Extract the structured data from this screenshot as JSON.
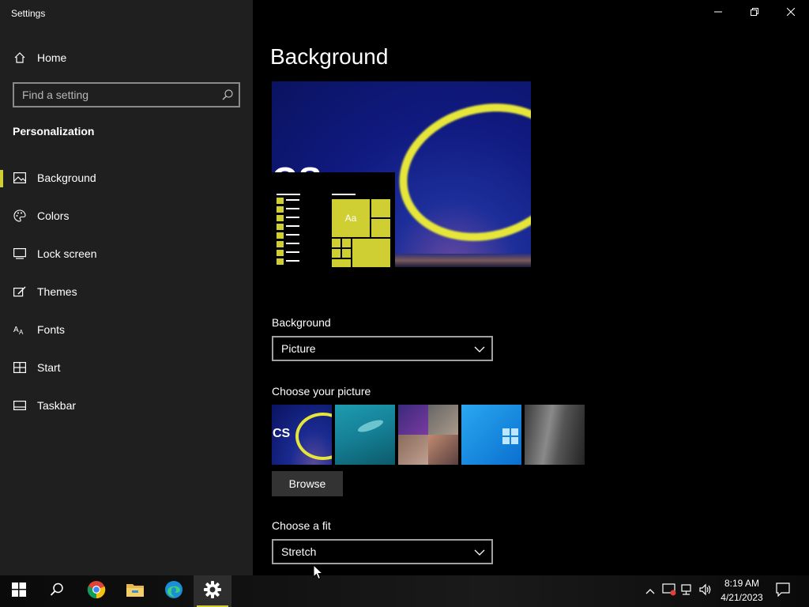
{
  "window": {
    "title": "Settings"
  },
  "sidebar": {
    "home_label": "Home",
    "search_placeholder": "Find a setting",
    "section_title": "Personalization",
    "items": [
      {
        "label": "Background",
        "icon": "picture-icon",
        "active": true
      },
      {
        "label": "Colors",
        "icon": "palette-icon",
        "active": false
      },
      {
        "label": "Lock screen",
        "icon": "lock-screen-icon",
        "active": false
      },
      {
        "label": "Themes",
        "icon": "themes-icon",
        "active": false
      },
      {
        "label": "Fonts",
        "icon": "fonts-icon",
        "active": false
      },
      {
        "label": "Start",
        "icon": "start-icon",
        "active": false
      },
      {
        "label": "Taskbar",
        "icon": "taskbar-icon",
        "active": false
      }
    ]
  },
  "main": {
    "title": "Background",
    "preview": {
      "sample_tile_text": "Aa",
      "wallpaper_text": "CS"
    },
    "background_label": "Background",
    "background_value": "Picture",
    "choose_picture_label": "Choose your picture",
    "pictures": [
      "cs-ring-wallpaper",
      "underwater-wallpaper",
      "collage-wallpaper",
      "windows-blue-wallpaper",
      "rock-cliff-wallpaper"
    ],
    "thumb1_text": "CS",
    "browse_label": "Browse",
    "fit_label": "Choose a fit",
    "fit_value": "Stretch"
  },
  "taskbar": {
    "apps": [
      "start-icon",
      "search-icon",
      "chrome-icon",
      "file-explorer-icon",
      "edge-icon",
      "settings-icon"
    ],
    "time": "8:19 AM",
    "date": "4/21/2023"
  },
  "colors": {
    "accent": "#cfcf33",
    "sidebar_bg": "#1f1f1f",
    "content_bg": "#000000"
  }
}
